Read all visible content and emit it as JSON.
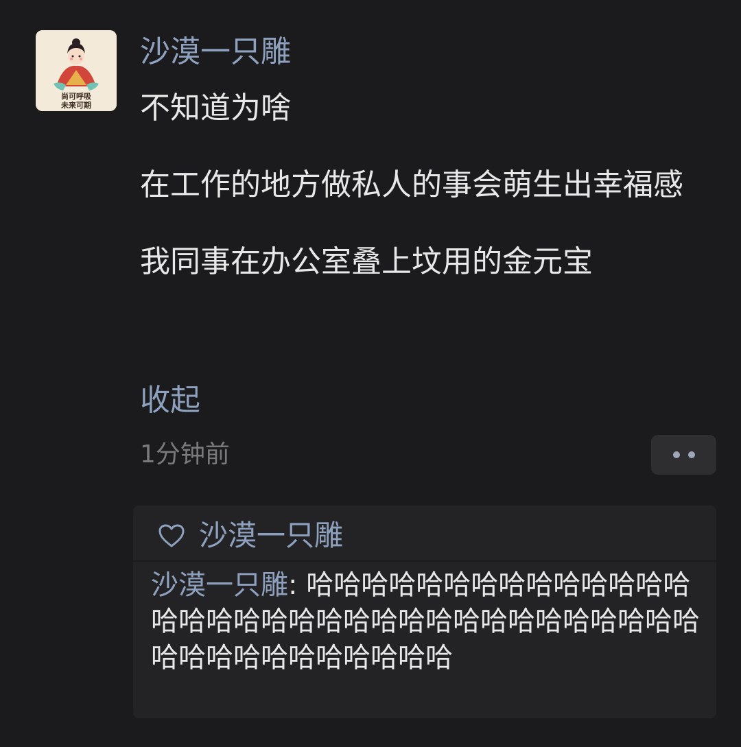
{
  "post": {
    "author": "沙漠一只雕",
    "avatar_text_line1": "尚可呼吸",
    "avatar_text_line2": "未来可期",
    "paragraph1": "不知道为啥",
    "paragraph2": "在工作的地方做私人的事会萌生出幸福感",
    "paragraph3": "我同事在办公室叠上坟用的金元宝",
    "collapse_label": "收起",
    "timestamp": "1分钟前"
  },
  "icons": {
    "more": "more-dots-icon",
    "like": "heart-icon"
  },
  "likes": {
    "names": "沙漠一只雕"
  },
  "comments": [
    {
      "author": "沙漠一只雕",
      "separator": ": ",
      "text": "哈哈哈哈哈哈哈哈哈哈哈哈哈哈哈哈哈哈哈哈哈哈哈哈哈哈哈哈哈哈哈哈哈哈哈哈哈哈哈哈哈哈哈哈哈"
    }
  ],
  "colors": {
    "background": "#1b1b1d",
    "link": "#8ea1be",
    "text": "#e8e8e8",
    "muted": "#7a7a7c",
    "panel": "#232325"
  }
}
